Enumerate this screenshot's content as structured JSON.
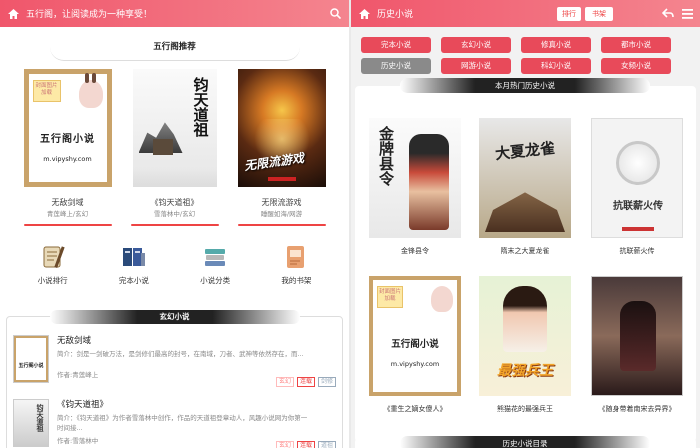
{
  "left": {
    "header": {
      "title": "五行阁，让阅读成为一种享受！"
    },
    "recommend": {
      "title": "五行阁推荐",
      "books": [
        {
          "name": "无敌剑域",
          "meta": "青莲峰上/玄幻",
          "cover_text": "五行阁小说",
          "cover_url": "m.vipyshy.com",
          "cover_label": "封面图片加载"
        },
        {
          "name": "《钧天道祖》",
          "meta": "雪落林中/玄幻",
          "cover_text": "钧天道祖"
        },
        {
          "name": "无限流游戏",
          "meta": "睡醒如海/网游",
          "cover_text": "无限流游戏"
        }
      ]
    },
    "categories": [
      {
        "label": "小说排行",
        "icon": "ranking-icon"
      },
      {
        "label": "完本小说",
        "icon": "books-icon"
      },
      {
        "label": "小说分类",
        "icon": "category-icon"
      },
      {
        "label": "我的书架",
        "icon": "bookshelf-icon"
      }
    ],
    "xuanhuan": {
      "title": "玄幻小说",
      "items": [
        {
          "name": "无敌剑域",
          "desc": "简介：剑是一剑破万法，是剑修们最高的封号，在南域，刀者、武神等依然存在，而...",
          "author": "作者:青莲峰上",
          "tags": [
            "玄幻",
            "连载",
            "剑修"
          ]
        },
        {
          "name": "《钧天道祖》",
          "desc": "简介：《钧天道祖》为作者雪落林中创作，作品的天道祖登章动人，风趣小说网为你第一",
          "author": "作者:雪落林中",
          "tags": [
            "玄幻",
            "连载",
            "道祖"
          ]
        }
      ],
      "second_desc_line": "时间接..."
    }
  },
  "right": {
    "header": {
      "title": "历史小说",
      "btn_rank": "排行",
      "btn_shelf": "书架"
    },
    "genres": [
      {
        "label": "完本小说",
        "color": "#e84a5a"
      },
      {
        "label": "玄幻小说",
        "color": "#e84a5a"
      },
      {
        "label": "修真小说",
        "color": "#e84a5a"
      },
      {
        "label": "都市小说",
        "color": "#e84a5a"
      },
      {
        "label": "历史小说",
        "color": "#8a8a8a"
      },
      {
        "label": "网游小说",
        "color": "#e84a5a"
      },
      {
        "label": "科幻小说",
        "color": "#e84a5a"
      },
      {
        "label": "女频小说",
        "color": "#e84a5a"
      }
    ],
    "hot": {
      "title": "本月热门历史小说",
      "books": [
        {
          "name": "金锋县令"
        },
        {
          "name": "隋末之大夏龙雀"
        },
        {
          "name": "抗联薪火传"
        },
        {
          "name": "《重生之嫡女傻人》"
        },
        {
          "name": "熊猫花的最强兵王"
        },
        {
          "name": "《随身带着南宋去异界》"
        }
      ],
      "cover_texts": [
        "金牌县令",
        "大夏龙雀",
        "抗联薪火传",
        "五行阁小说",
        "最强兵王"
      ],
      "cover_url": "m.vipyshy.com",
      "cover_label": "封面图片加载"
    },
    "bottom_title": "历史小说目录"
  },
  "colors": {
    "accent": "#e84a5a",
    "gray_btn": "#8a8a8a"
  }
}
